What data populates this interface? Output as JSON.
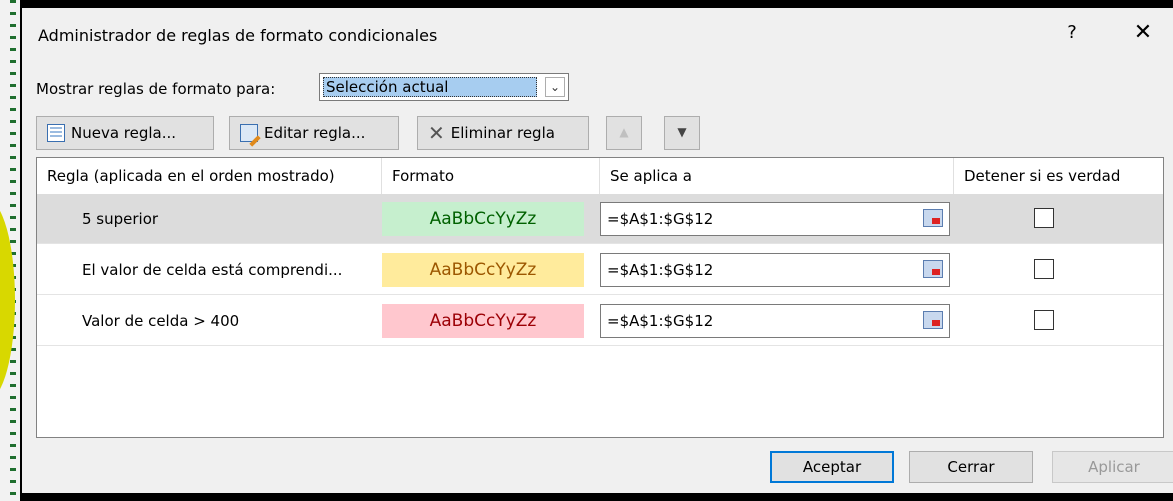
{
  "dialog": {
    "title": "Administrador de reglas de formato condicionales",
    "help": "?",
    "close": "✕"
  },
  "show_rules": {
    "label": "Mostrar reglas de formato para:",
    "selected": "Selección actual"
  },
  "toolbar": {
    "new_rule": "Nueva regla...",
    "edit_rule": "Editar regla...",
    "delete_rule": "Eliminar regla",
    "move_up": "▲",
    "move_down": "▼"
  },
  "columns": [
    "Regla (aplicada en el orden mostrado)",
    "Formato",
    "Se aplica a",
    "Detener si es verdad"
  ],
  "rules": [
    {
      "name": "5 superior",
      "sample": "AaBbCcYyZz",
      "range": "=$A$1:$G$12",
      "stop": false,
      "fill": "#c6efce",
      "text_color": "#006100"
    },
    {
      "name": "El valor de celda está comprendi...",
      "sample": "AaBbCcYyZz",
      "range": "=$A$1:$G$12",
      "stop": false,
      "fill": "#ffeb9c",
      "text_color": "#9c5700"
    },
    {
      "name": "Valor de celda > 400",
      "sample": "AaBbCcYyZz",
      "range": "=$A$1:$G$12",
      "stop": false,
      "fill": "#ffc7ce",
      "text_color": "#9c0006"
    }
  ],
  "footer": {
    "ok": "Aceptar",
    "close": "Cerrar",
    "apply": "Aplicar"
  }
}
